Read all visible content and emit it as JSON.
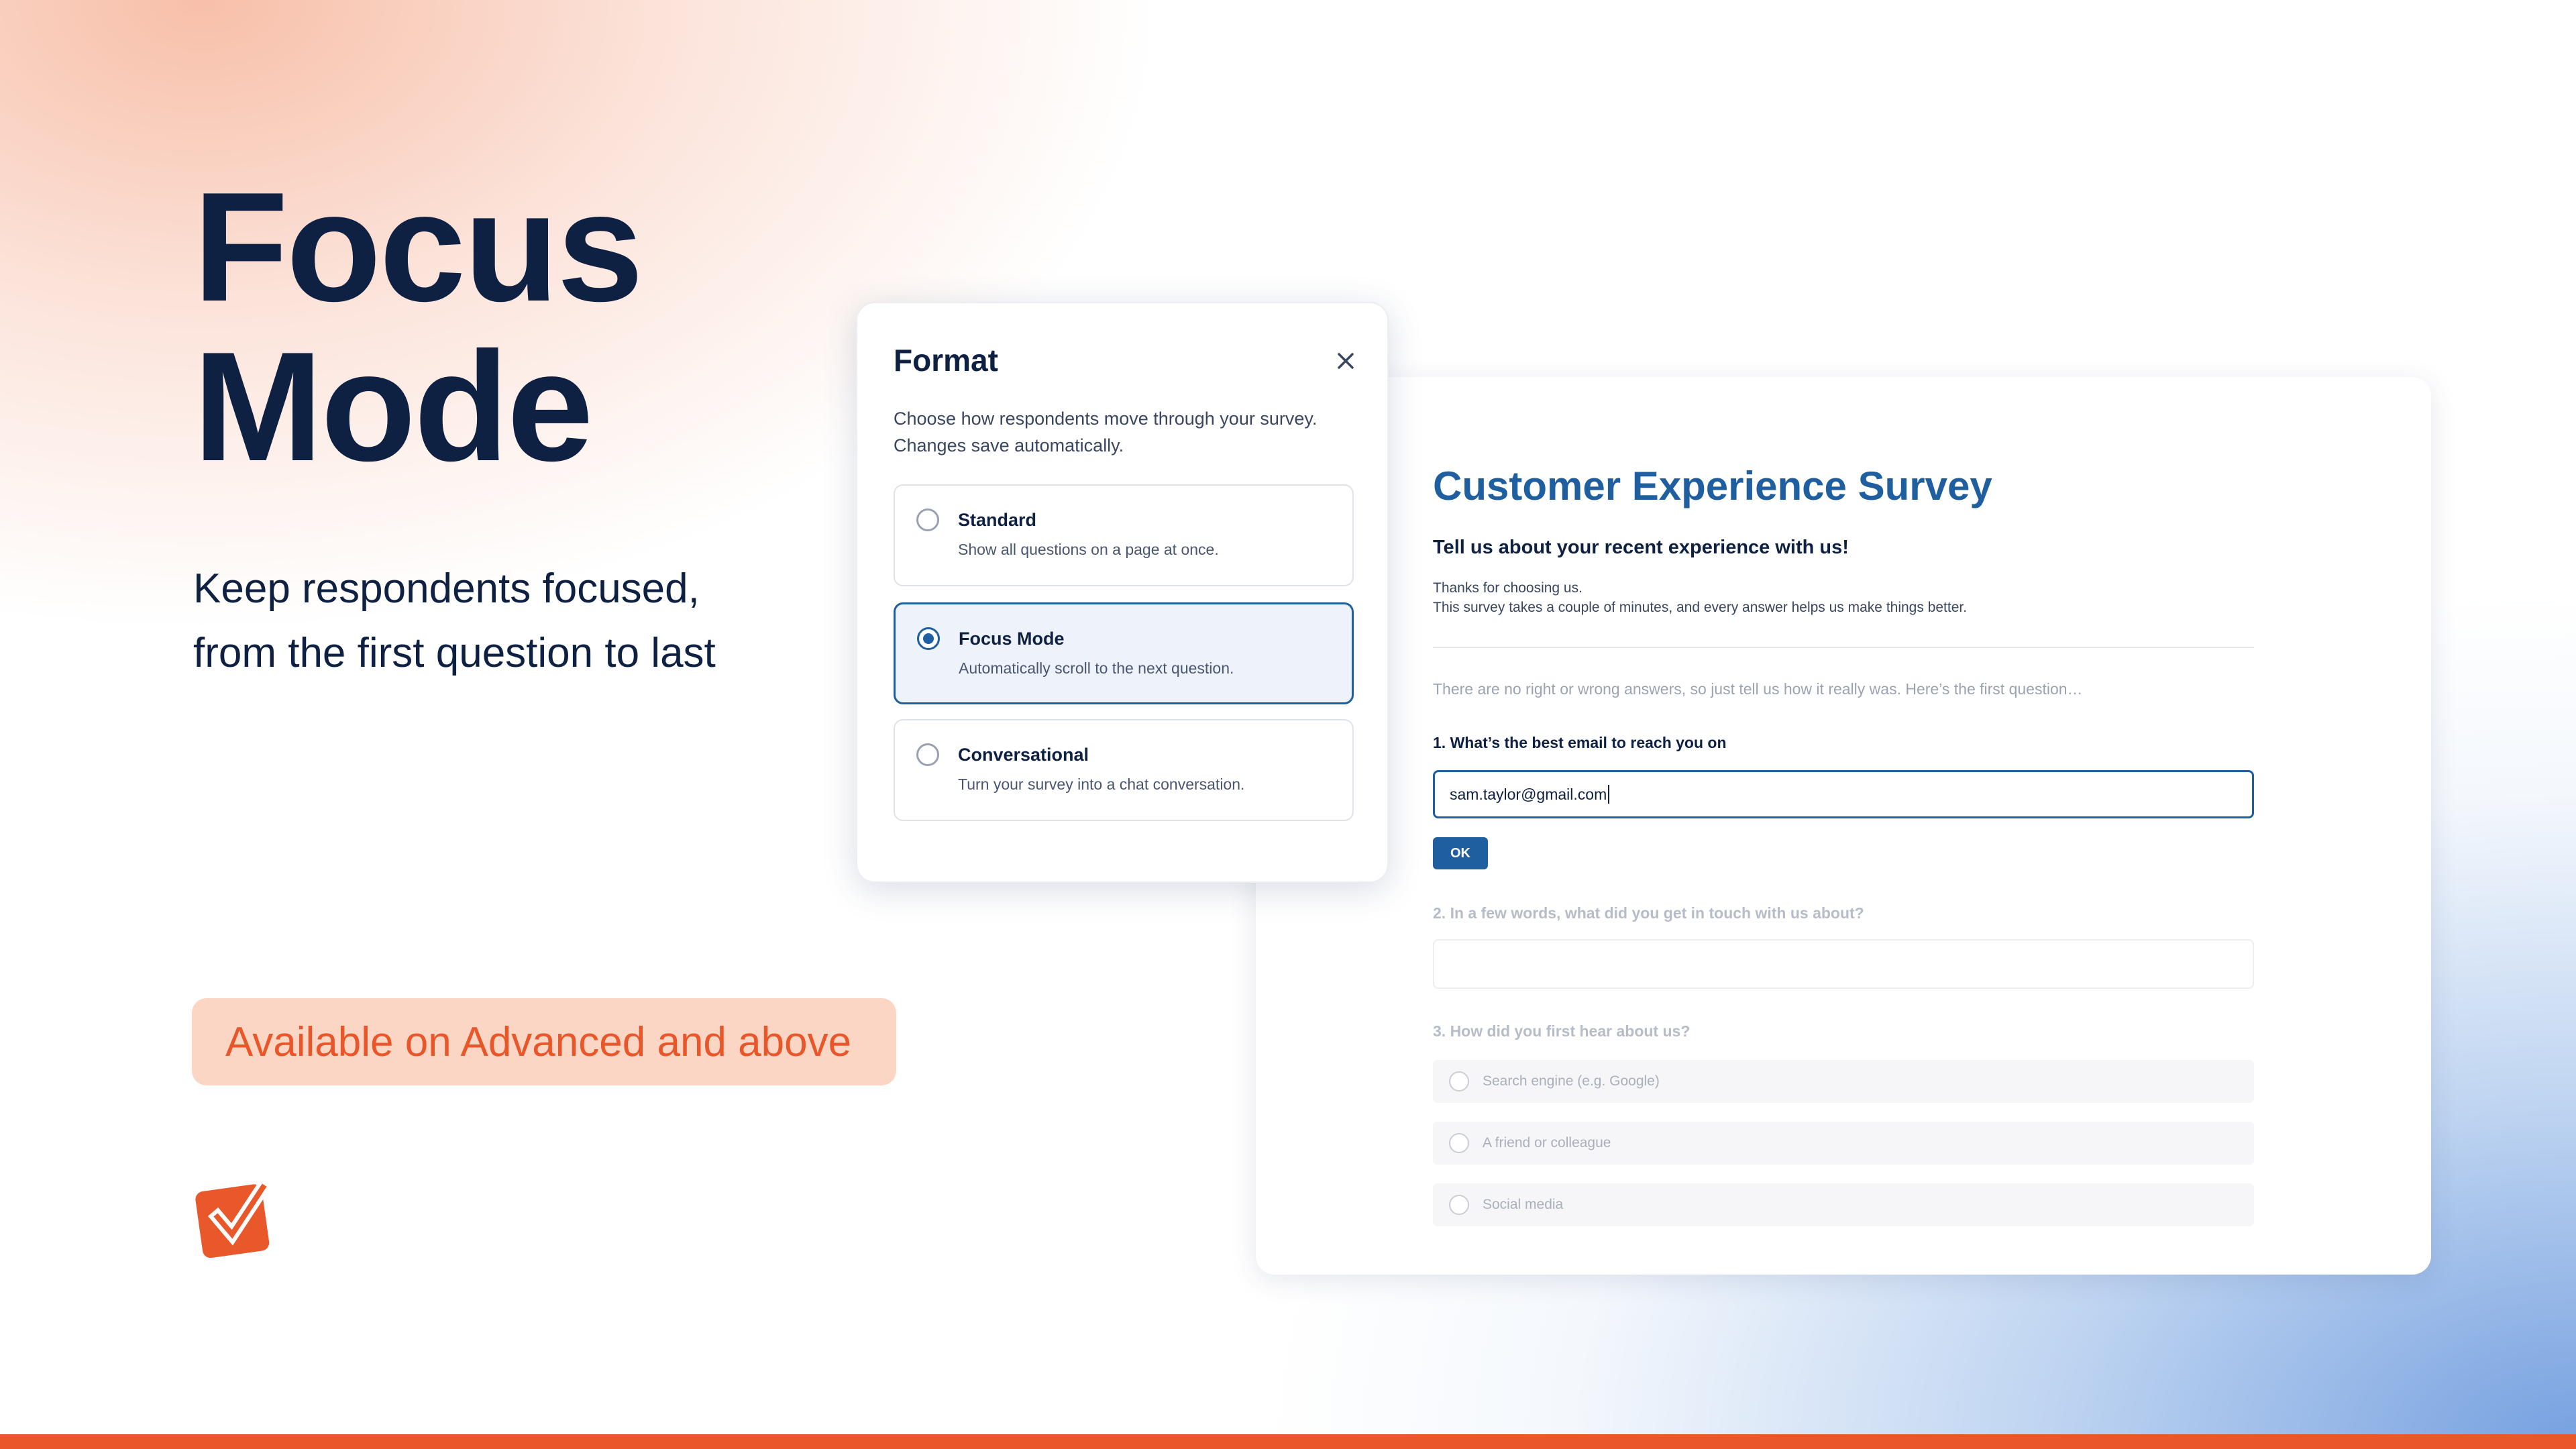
{
  "hero": {
    "title_line1": "Focus",
    "title_line2": "Mode",
    "subtitle_line1": "Keep respondents focused,",
    "subtitle_line2": "from the first question to last",
    "availability": "Available on Advanced and above"
  },
  "colors": {
    "accent_orange": "#e8582a",
    "navy": "#0f2142",
    "primary_blue": "#1f5fa0",
    "pill_bg": "#fbd6c4"
  },
  "logo": {
    "icon": "checkbox-check-icon"
  },
  "format_dialog": {
    "title": "Format",
    "close_icon": "close-icon",
    "description_line1": "Choose how respondents move through your survey.",
    "description_line2": "Changes save automatically.",
    "selected": "Focus Mode",
    "options": [
      {
        "title": "Standard",
        "description": "Show all questions on a page at once."
      },
      {
        "title": "Focus Mode",
        "description": "Automatically scroll to the next question."
      },
      {
        "title": "Conversational",
        "description": "Turn your survey into a chat conversation."
      }
    ]
  },
  "survey": {
    "title": "Customer Experience Survey",
    "subtitle": "Tell us about your recent experience with us!",
    "description_line1": "Thanks for choosing us.",
    "description_line2": "This survey takes a couple of minutes, and every answer helps us make things better.",
    "intro": "There are no right or wrong answers, so just tell us how it really was. Here’s the first question…",
    "q1": {
      "label": "1. What’s the best email to reach you on",
      "value": "sam.taylor@gmail.com",
      "ok_label": "OK"
    },
    "q2": {
      "label": "2. In a few words, what did you get in touch with us about?",
      "value": ""
    },
    "q3": {
      "label": "3. How did you first hear about us?",
      "choices": [
        "Search engine (e.g. Google)",
        "A friend or colleague",
        "Social media"
      ]
    }
  }
}
